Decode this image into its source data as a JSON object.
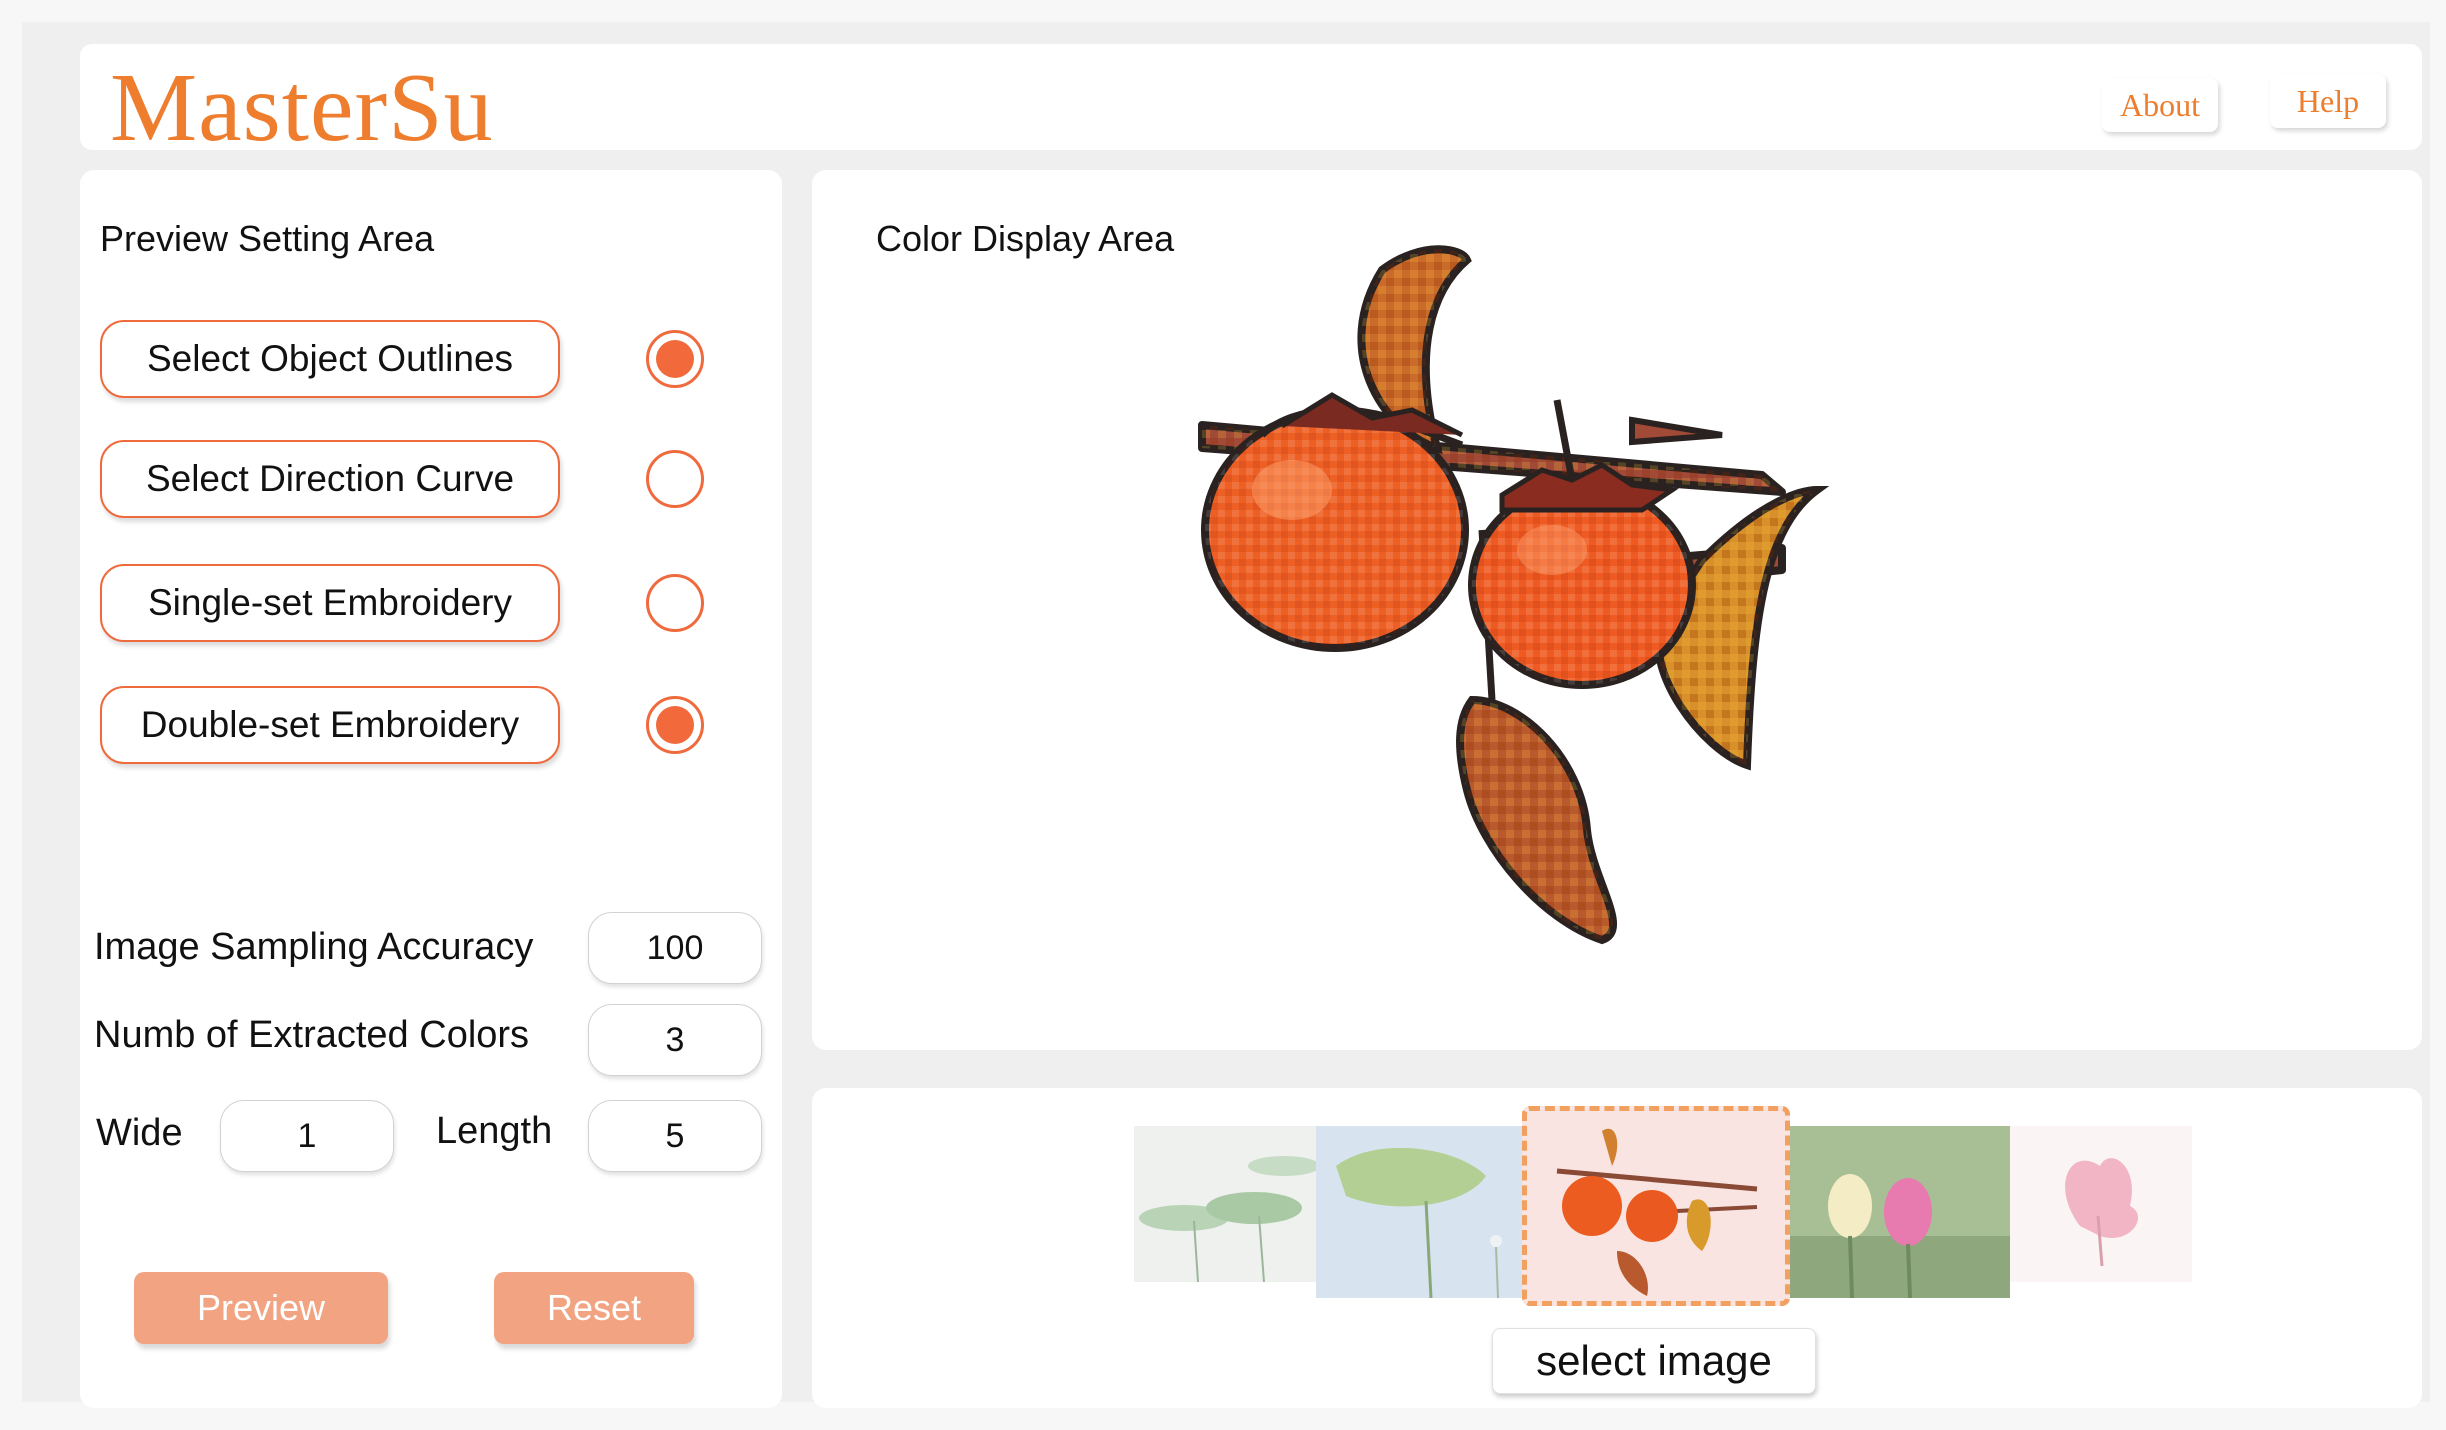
{
  "app": {
    "logo": "MasterSu",
    "nav": {
      "about": "About",
      "help": "Help"
    }
  },
  "settings": {
    "title": "Preview Setting Area",
    "options": [
      {
        "label": "Select Object Outlines",
        "selected": true
      },
      {
        "label": "Select Direction Curve",
        "selected": false
      },
      {
        "label": "Single-set Embroidery",
        "selected": false
      },
      {
        "label": "Double-set Embroidery",
        "selected": true
      }
    ],
    "fields": {
      "sampling_label": "Image Sampling Accuracy",
      "sampling_value": "100",
      "colors_label": "Numb of Extracted Colors",
      "colors_value": "3",
      "wide_label": "Wide",
      "wide_value": "1",
      "length_label": "Length",
      "length_value": "5"
    },
    "preview_label": "Preview",
    "reset_label": "Reset"
  },
  "display": {
    "title": "Color Display Area",
    "image": "pixelated persimmon branch illustration"
  },
  "gallery": {
    "thumbnails": [
      {
        "name": "lotus-leaves-thumbnail",
        "selected": false
      },
      {
        "name": "lotus-leaf-blue-thumbnail",
        "selected": false
      },
      {
        "name": "persimmon-thumbnail",
        "selected": true
      },
      {
        "name": "tulips-thumbnail",
        "selected": false
      },
      {
        "name": "pink-flower-thumbnail",
        "selected": false
      }
    ],
    "select_label": "select image"
  },
  "colors": {
    "accent": "#ee7d2e",
    "radio": "#f26a3b",
    "button": "#f2a381"
  }
}
